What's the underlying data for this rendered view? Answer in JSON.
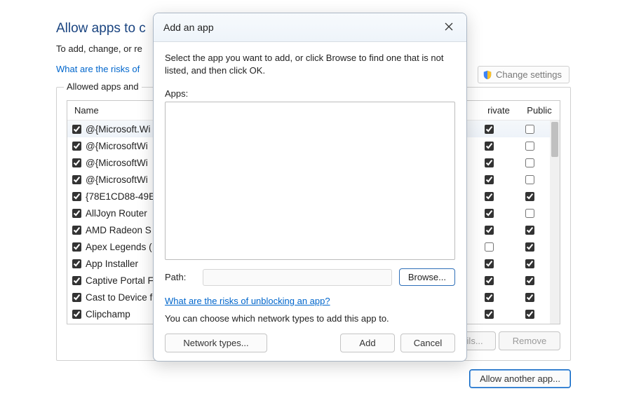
{
  "page": {
    "title": "Allow apps to c",
    "subtitle": "To add, change, or re",
    "risks_link": "What are the risks of",
    "change_settings": "Change settings",
    "fieldset_legend": "Allowed apps and",
    "columns": {
      "name": "Name",
      "private": "rivate",
      "public": "Public"
    },
    "rows": [
      {
        "name": "@{Microsoft.Wi",
        "checked": true,
        "priv": true,
        "pub": false,
        "sel": true
      },
      {
        "name": "@{MicrosoftWi",
        "checked": true,
        "priv": true,
        "pub": false,
        "sel": false
      },
      {
        "name": "@{MicrosoftWi",
        "checked": true,
        "priv": true,
        "pub": false,
        "sel": false
      },
      {
        "name": "@{MicrosoftWi",
        "checked": true,
        "priv": true,
        "pub": false,
        "sel": false
      },
      {
        "name": "{78E1CD88-49E",
        "checked": true,
        "priv": true,
        "pub": true,
        "sel": false
      },
      {
        "name": "AllJoyn Router",
        "checked": true,
        "priv": true,
        "pub": false,
        "sel": false
      },
      {
        "name": "AMD Radeon S",
        "checked": true,
        "priv": true,
        "pub": true,
        "sel": false
      },
      {
        "name": "Apex Legends (",
        "checked": true,
        "priv": false,
        "pub": true,
        "sel": false
      },
      {
        "name": "App Installer",
        "checked": true,
        "priv": true,
        "pub": true,
        "sel": false
      },
      {
        "name": "Captive Portal F",
        "checked": true,
        "priv": true,
        "pub": true,
        "sel": false
      },
      {
        "name": "Cast to Device f",
        "checked": true,
        "priv": true,
        "pub": true,
        "sel": false
      },
      {
        "name": "Clipchamp",
        "checked": true,
        "priv": true,
        "pub": true,
        "sel": false
      }
    ],
    "details_btn": "Details...",
    "remove_btn": "Remove",
    "allow_another": "Allow another app..."
  },
  "dialog": {
    "title": "Add an app",
    "instruction": "Select the app you want to add, or click Browse to find one that is not listed, and then click OK.",
    "apps_label": "Apps:",
    "path_label": "Path:",
    "path_value": "",
    "browse": "Browse...",
    "unblock_link": "What are the risks of unblocking an app?",
    "network_hint": "You can choose which network types to add this app to.",
    "network_types_btn": "Network types...",
    "add_btn": "Add",
    "cancel_btn": "Cancel"
  }
}
